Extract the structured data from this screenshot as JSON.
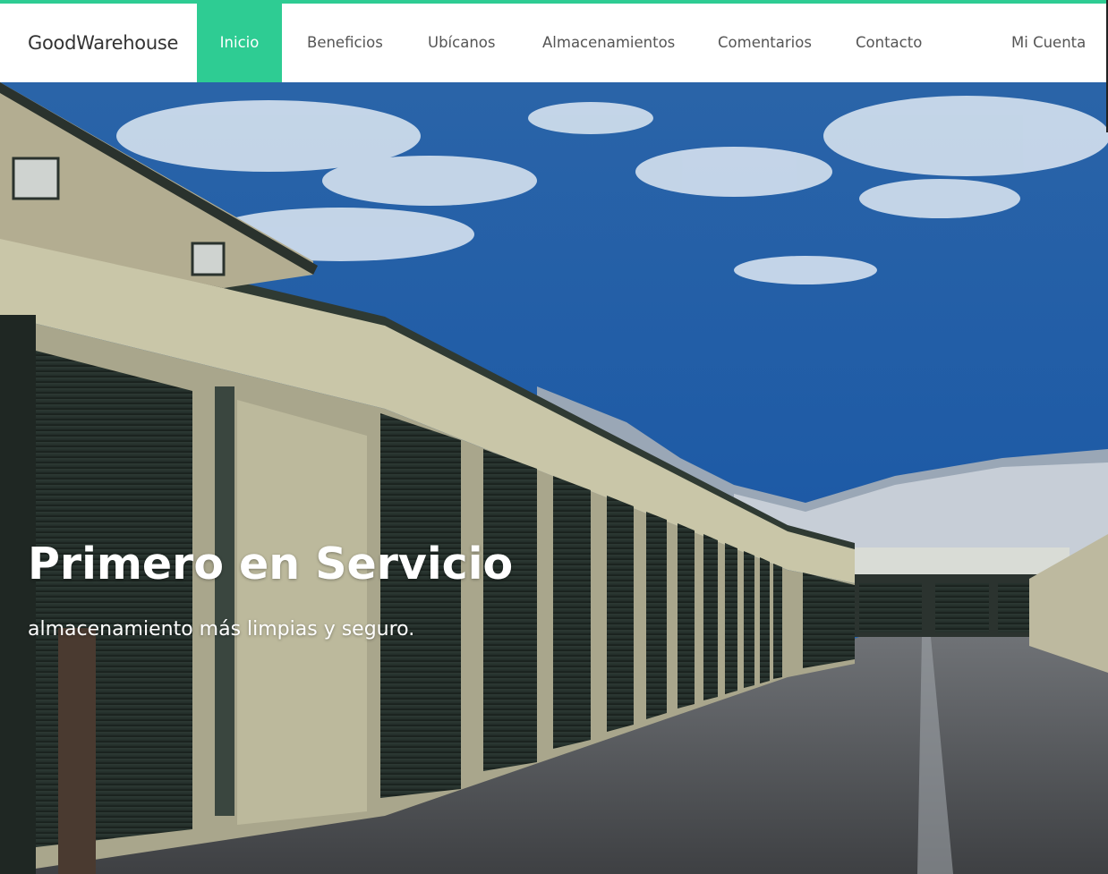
{
  "brand": "GoodWarehouse",
  "nav": {
    "items": [
      {
        "label": "Inicio",
        "active": true
      },
      {
        "label": "Beneficios",
        "active": false
      },
      {
        "label": "Ubícanos",
        "active": false
      },
      {
        "label": "Almacenamientos",
        "active": false
      },
      {
        "label": "Comentarios",
        "active": false
      },
      {
        "label": "Contacto",
        "active": false
      }
    ],
    "account": "Mi Cuenta"
  },
  "hero": {
    "title": "Primero en Servicio",
    "subtitle": "almacenamiento más limpias y seguro."
  },
  "colors": {
    "accent": "#2ecc93",
    "nav_text": "#555555",
    "brand_text": "#333333"
  }
}
